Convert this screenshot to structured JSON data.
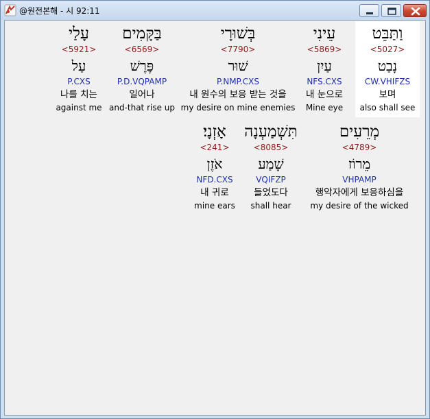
{
  "window": {
    "title": "@원전본해 - 시 92:11"
  },
  "words": [
    {
      "hebrew": "וַתַּבֵּט",
      "strong": "<5027>",
      "lemma": "נָבַט",
      "morph": "CW.VHIFZS",
      "korean": "보며",
      "english": "also shall see",
      "selected": true
    },
    {
      "hebrew": "עֵינִי",
      "strong": "<5869>",
      "lemma": "עַיִן",
      "morph": "NFS.CXS",
      "korean": "내 눈으로",
      "english": "Mine eye"
    },
    {
      "hebrew": "בְּשׁוּרָי",
      "strong": "<7790>",
      "lemma": "שׁוּר",
      "morph": "P.NMP.CXS",
      "korean": "내 원수의 보응 받는 것을",
      "english": "my desire on mine enemies"
    },
    {
      "hebrew": "בַּקָּמִים",
      "strong": "<6569>",
      "lemma": "פֶּרֶשׁ",
      "morph": "P.D.VQPAMP",
      "korean": "일어나",
      "english": "and-that rise up"
    },
    {
      "hebrew": "עָלַי",
      "strong": "<5921>",
      "lemma": "עַל",
      "morph": "P.CXS",
      "korean": "나를 치는",
      "english": "against me"
    },
    {
      "hebrew": "מְרֵעִים",
      "strong": "<4789>",
      "lemma": "מֵרוֹז",
      "morph": "VHPAMP",
      "korean": "행악자에게 보응하심을",
      "english": "my desire of the wicked"
    },
    {
      "hebrew": "תִּשְׁמַעְנָה",
      "strong": "<8085>",
      "lemma": "שָׁמַע",
      "morph": "VQIFZP",
      "korean": "들었도다",
      "english": "shall hear"
    },
    {
      "hebrew": "אָזְנָי׃",
      "strong": "<241>",
      "lemma": "אֹזֶן",
      "morph": "NFD.CXS",
      "korean": "내 귀로",
      "english": "mine ears"
    }
  ]
}
